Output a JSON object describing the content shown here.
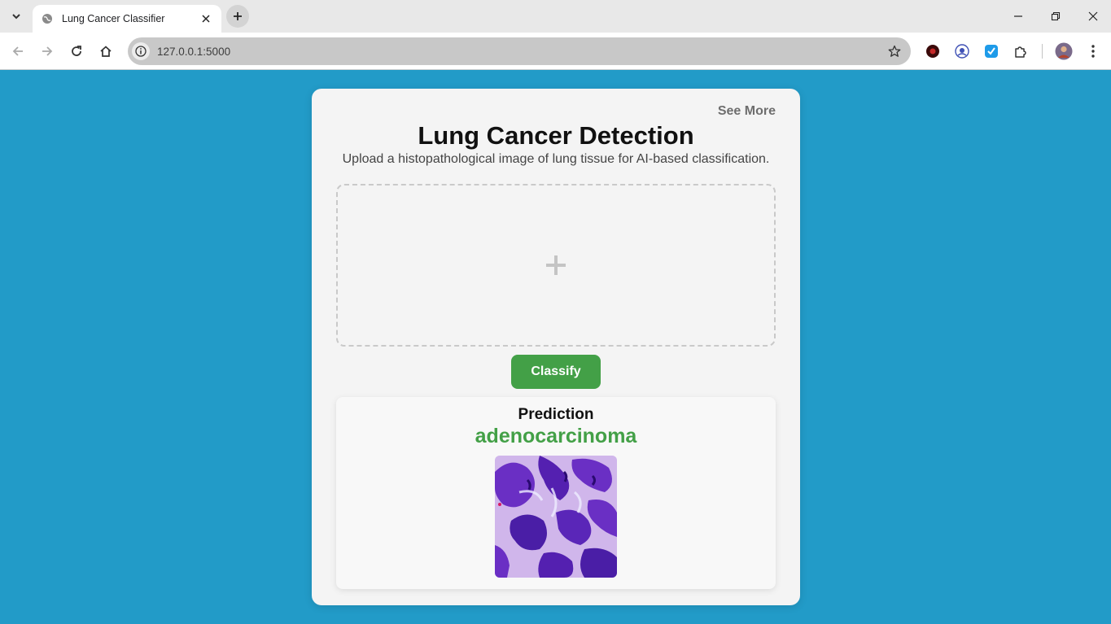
{
  "browser": {
    "tab_title": "Lung Cancer Classifier",
    "url": "127.0.0.1:5000",
    "accent": "#229bc8"
  },
  "page": {
    "see_more": "See More",
    "title": "Lung Cancer Detection",
    "subtitle": "Upload a histopathological image of lung tissue for AI-based classification.",
    "dropzone_icon": "plus-icon",
    "classify_label": "Classify",
    "prediction_label": "Prediction",
    "prediction_value": "adenocarcinoma",
    "prediction_color": "#43a047",
    "button_color": "#43a047"
  }
}
